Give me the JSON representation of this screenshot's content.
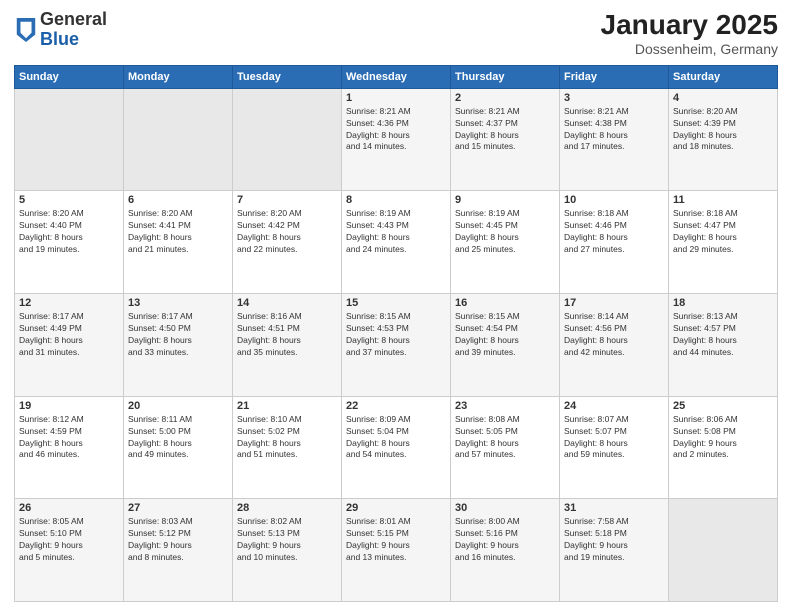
{
  "logo": {
    "general": "General",
    "blue": "Blue"
  },
  "title": "January 2025",
  "subtitle": "Dossenheim, Germany",
  "weekdays": [
    "Sunday",
    "Monday",
    "Tuesday",
    "Wednesday",
    "Thursday",
    "Friday",
    "Saturday"
  ],
  "weeks": [
    [
      {
        "day": "",
        "info": ""
      },
      {
        "day": "",
        "info": ""
      },
      {
        "day": "",
        "info": ""
      },
      {
        "day": "1",
        "info": "Sunrise: 8:21 AM\nSunset: 4:36 PM\nDaylight: 8 hours\nand 14 minutes."
      },
      {
        "day": "2",
        "info": "Sunrise: 8:21 AM\nSunset: 4:37 PM\nDaylight: 8 hours\nand 15 minutes."
      },
      {
        "day": "3",
        "info": "Sunrise: 8:21 AM\nSunset: 4:38 PM\nDaylight: 8 hours\nand 17 minutes."
      },
      {
        "day": "4",
        "info": "Sunrise: 8:20 AM\nSunset: 4:39 PM\nDaylight: 8 hours\nand 18 minutes."
      }
    ],
    [
      {
        "day": "5",
        "info": "Sunrise: 8:20 AM\nSunset: 4:40 PM\nDaylight: 8 hours\nand 19 minutes."
      },
      {
        "day": "6",
        "info": "Sunrise: 8:20 AM\nSunset: 4:41 PM\nDaylight: 8 hours\nand 21 minutes."
      },
      {
        "day": "7",
        "info": "Sunrise: 8:20 AM\nSunset: 4:42 PM\nDaylight: 8 hours\nand 22 minutes."
      },
      {
        "day": "8",
        "info": "Sunrise: 8:19 AM\nSunset: 4:43 PM\nDaylight: 8 hours\nand 24 minutes."
      },
      {
        "day": "9",
        "info": "Sunrise: 8:19 AM\nSunset: 4:45 PM\nDaylight: 8 hours\nand 25 minutes."
      },
      {
        "day": "10",
        "info": "Sunrise: 8:18 AM\nSunset: 4:46 PM\nDaylight: 8 hours\nand 27 minutes."
      },
      {
        "day": "11",
        "info": "Sunrise: 8:18 AM\nSunset: 4:47 PM\nDaylight: 8 hours\nand 29 minutes."
      }
    ],
    [
      {
        "day": "12",
        "info": "Sunrise: 8:17 AM\nSunset: 4:49 PM\nDaylight: 8 hours\nand 31 minutes."
      },
      {
        "day": "13",
        "info": "Sunrise: 8:17 AM\nSunset: 4:50 PM\nDaylight: 8 hours\nand 33 minutes."
      },
      {
        "day": "14",
        "info": "Sunrise: 8:16 AM\nSunset: 4:51 PM\nDaylight: 8 hours\nand 35 minutes."
      },
      {
        "day": "15",
        "info": "Sunrise: 8:15 AM\nSunset: 4:53 PM\nDaylight: 8 hours\nand 37 minutes."
      },
      {
        "day": "16",
        "info": "Sunrise: 8:15 AM\nSunset: 4:54 PM\nDaylight: 8 hours\nand 39 minutes."
      },
      {
        "day": "17",
        "info": "Sunrise: 8:14 AM\nSunset: 4:56 PM\nDaylight: 8 hours\nand 42 minutes."
      },
      {
        "day": "18",
        "info": "Sunrise: 8:13 AM\nSunset: 4:57 PM\nDaylight: 8 hours\nand 44 minutes."
      }
    ],
    [
      {
        "day": "19",
        "info": "Sunrise: 8:12 AM\nSunset: 4:59 PM\nDaylight: 8 hours\nand 46 minutes."
      },
      {
        "day": "20",
        "info": "Sunrise: 8:11 AM\nSunset: 5:00 PM\nDaylight: 8 hours\nand 49 minutes."
      },
      {
        "day": "21",
        "info": "Sunrise: 8:10 AM\nSunset: 5:02 PM\nDaylight: 8 hours\nand 51 minutes."
      },
      {
        "day": "22",
        "info": "Sunrise: 8:09 AM\nSunset: 5:04 PM\nDaylight: 8 hours\nand 54 minutes."
      },
      {
        "day": "23",
        "info": "Sunrise: 8:08 AM\nSunset: 5:05 PM\nDaylight: 8 hours\nand 57 minutes."
      },
      {
        "day": "24",
        "info": "Sunrise: 8:07 AM\nSunset: 5:07 PM\nDaylight: 8 hours\nand 59 minutes."
      },
      {
        "day": "25",
        "info": "Sunrise: 8:06 AM\nSunset: 5:08 PM\nDaylight: 9 hours\nand 2 minutes."
      }
    ],
    [
      {
        "day": "26",
        "info": "Sunrise: 8:05 AM\nSunset: 5:10 PM\nDaylight: 9 hours\nand 5 minutes."
      },
      {
        "day": "27",
        "info": "Sunrise: 8:03 AM\nSunset: 5:12 PM\nDaylight: 9 hours\nand 8 minutes."
      },
      {
        "day": "28",
        "info": "Sunrise: 8:02 AM\nSunset: 5:13 PM\nDaylight: 9 hours\nand 10 minutes."
      },
      {
        "day": "29",
        "info": "Sunrise: 8:01 AM\nSunset: 5:15 PM\nDaylight: 9 hours\nand 13 minutes."
      },
      {
        "day": "30",
        "info": "Sunrise: 8:00 AM\nSunset: 5:16 PM\nDaylight: 9 hours\nand 16 minutes."
      },
      {
        "day": "31",
        "info": "Sunrise: 7:58 AM\nSunset: 5:18 PM\nDaylight: 9 hours\nand 19 minutes."
      },
      {
        "day": "",
        "info": ""
      }
    ]
  ]
}
